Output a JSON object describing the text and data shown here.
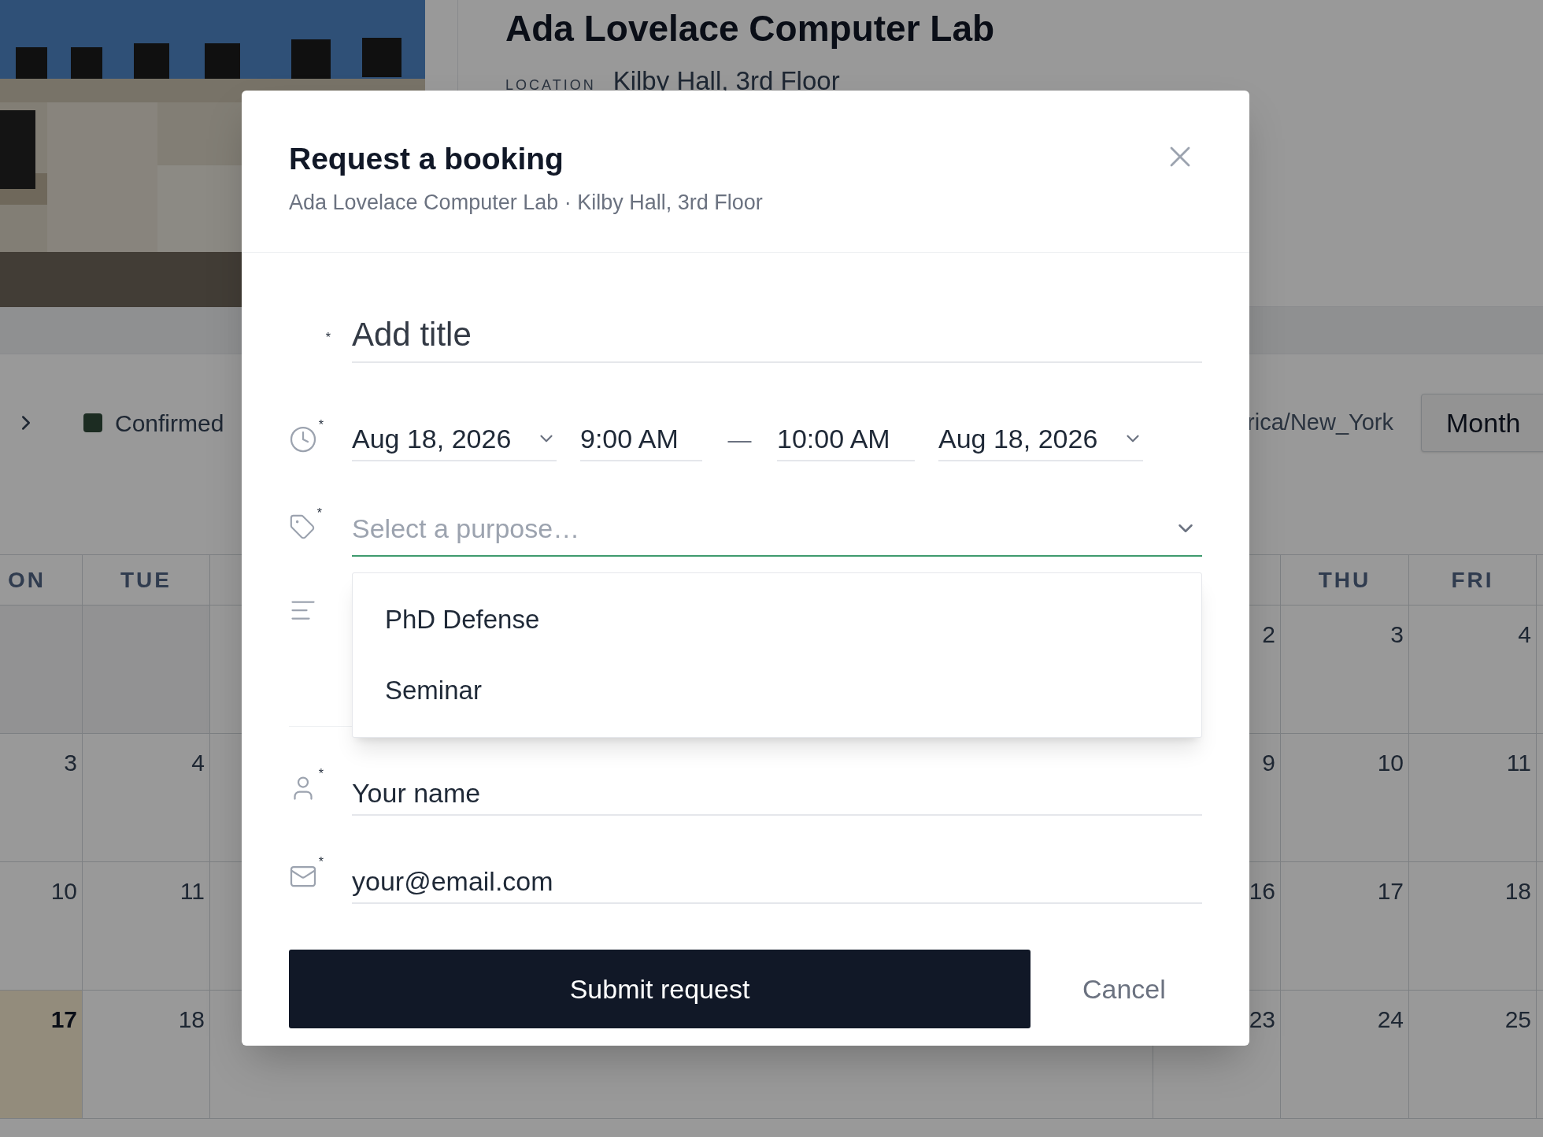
{
  "page": {
    "title": "Ada Lovelace Computer Lab",
    "location_label": "LOCATION",
    "location": "Kilby Hall, 3rd Floor"
  },
  "toolbar": {
    "legend": [
      {
        "label": "Confirmed",
        "color": "#2f4a3a"
      }
    ],
    "timezone": "rica/New_York",
    "view_button": "Month"
  },
  "calendar": {
    "left_headers": [
      "ON",
      "TUE"
    ],
    "right_headers": [
      "THU",
      "FRI"
    ],
    "weeks": [
      {
        "cells": [
          {
            "kind": "empty"
          },
          {
            "kind": "empty"
          },
          {
            "kind": "day",
            "label": "2",
            "today": false
          },
          {
            "kind": "day",
            "label": "3",
            "today": false
          },
          {
            "kind": "day",
            "label": "4",
            "today": false
          }
        ]
      },
      {
        "cells": [
          {
            "kind": "day",
            "label": "3",
            "today": false
          },
          {
            "kind": "day",
            "label": "4",
            "today": false
          },
          {
            "kind": "day",
            "label": "9",
            "today": false
          },
          {
            "kind": "day",
            "label": "10",
            "today": false
          },
          {
            "kind": "day",
            "label": "11",
            "today": false
          }
        ]
      },
      {
        "cells": [
          {
            "kind": "day",
            "label": "10",
            "today": false
          },
          {
            "kind": "day",
            "label": "11",
            "today": false
          },
          {
            "kind": "day",
            "label": "16",
            "today": false
          },
          {
            "kind": "day",
            "label": "17",
            "today": false
          },
          {
            "kind": "day",
            "label": "18",
            "today": false
          }
        ]
      },
      {
        "cells": [
          {
            "kind": "day",
            "label": "17",
            "today": true
          },
          {
            "kind": "day",
            "label": "18",
            "today": false
          },
          {
            "kind": "day",
            "label": "23",
            "today": false
          },
          {
            "kind": "day",
            "label": "24",
            "today": false
          },
          {
            "kind": "day",
            "label": "25",
            "today": false
          }
        ]
      }
    ]
  },
  "dialog": {
    "title": "Request a booking",
    "subtitle": "Ada Lovelace Computer Lab · Kilby Hall, 3rd Floor",
    "required_mark": "*",
    "title_field": {
      "placeholder": "Add title",
      "required": true
    },
    "when": {
      "required": true,
      "start_date": "Aug 18, 2026",
      "start_time": "9:00 AM",
      "separator": "—",
      "end_time": "10:00 AM",
      "end_date": "Aug 18, 2026"
    },
    "purpose": {
      "placeholder": "Select a purpose…",
      "required": true,
      "expanded": true,
      "options": [
        {
          "label": "PhD Defense",
          "selected": false
        },
        {
          "label": "Seminar",
          "selected": false
        }
      ]
    },
    "name_field": {
      "placeholder": "Your name",
      "required": true
    },
    "email_field": {
      "placeholder": "your@email.com",
      "required": true
    },
    "submit": "Submit request",
    "cancel": "Cancel"
  }
}
